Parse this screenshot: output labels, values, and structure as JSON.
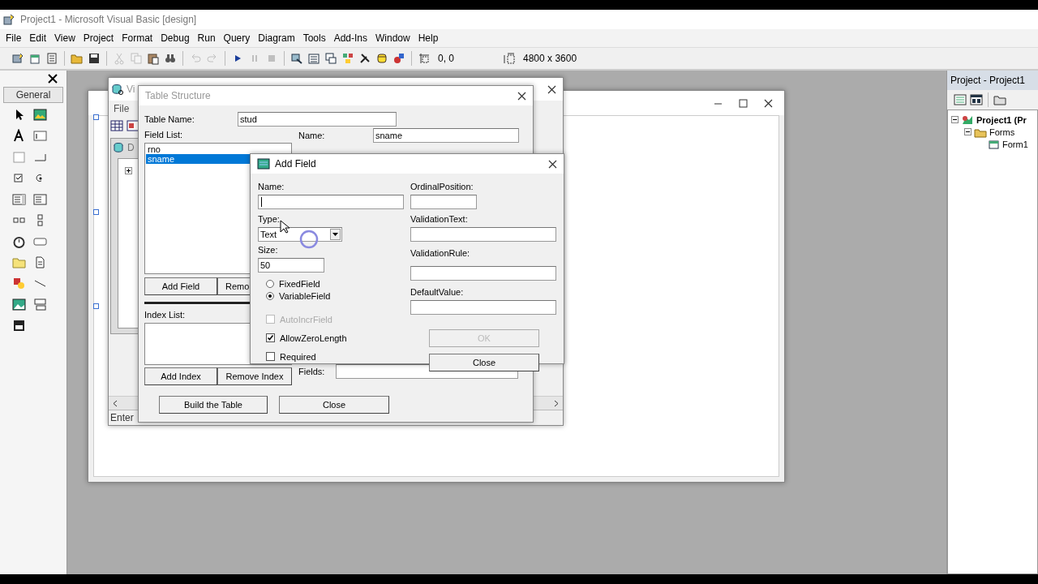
{
  "window": {
    "title": "Project1 - Microsoft Visual Basic [design]"
  },
  "menu": [
    "File",
    "Edit",
    "View",
    "Project",
    "Format",
    "Debug",
    "Run",
    "Query",
    "Diagram",
    "Tools",
    "Add-Ins",
    "Window",
    "Help"
  ],
  "toolbar": {
    "buttons": [
      {
        "disabled": false
      },
      {
        "disabled": false
      },
      {
        "disabled": false
      },
      {
        "disabled": false
      },
      {
        "disabled": false
      },
      {
        "disabled": true
      },
      {
        "disabled": true
      },
      {
        "disabled": false
      },
      {
        "disabled": false
      },
      {
        "disabled": true
      },
      {
        "disabled": true
      },
      {
        "disabled": false
      },
      {
        "disabled": true
      },
      {
        "disabled": true
      },
      {
        "disabled": false
      },
      {
        "disabled": false
      },
      {
        "disabled": false
      },
      {
        "disabled": false
      },
      {
        "disabled": false
      },
      {
        "disabled": false
      },
      {
        "disabled": false
      }
    ],
    "position": "0, 0",
    "size": "4800 x 3600"
  },
  "toolbox": {
    "tab": "General"
  },
  "visdata": {
    "title": "Vi",
    "menu": [
      "File"
    ],
    "child_title": "D",
    "status": "Enter"
  },
  "table_structure": {
    "title": "Table Structure",
    "table_name_label": "Table Name:",
    "table_name": "stud",
    "field_list_label": "Field List:",
    "fields": [
      {
        "name": "rno",
        "selected": false
      },
      {
        "name": "sname",
        "selected": true
      }
    ],
    "add_field": "Add Field",
    "remove_field": "Remo",
    "index_list_label": "Index List:",
    "add_index": "Add Index",
    "remove_index": "Remove Index",
    "name_label": "Name:",
    "name": "sname",
    "fields_label": "Fields:",
    "build": "Build the Table",
    "close": "Close"
  },
  "add_field": {
    "title": "Add Field",
    "name_label": "Name:",
    "type_label": "Type:",
    "type": "Text",
    "size_label": "Size:",
    "size": "50",
    "radios": [
      {
        "label": "FixedField",
        "selected": false
      },
      {
        "label": "VariableField",
        "selected": true
      }
    ],
    "checks": [
      {
        "label": "AutoIncrField",
        "checked": false,
        "disabled": true
      },
      {
        "label": "AllowZeroLength",
        "checked": true,
        "disabled": false
      },
      {
        "label": "Required",
        "checked": false,
        "disabled": false
      }
    ],
    "ordinal_label": "OrdinalPosition:",
    "validation_text_label": "ValidationText:",
    "validation_rule_label": "ValidationRule:",
    "default_value_label": "DefaultValue:",
    "ok": {
      "label": "OK",
      "disabled": true
    },
    "close": "Close"
  },
  "project": {
    "title": "Project - Project1",
    "tree": [
      {
        "label": "Project1 (Pr",
        "expanded": true,
        "children": [
          {
            "label": "Forms",
            "expanded": true,
            "children": [
              {
                "label": "Form1"
              }
            ]
          }
        ]
      }
    ]
  }
}
